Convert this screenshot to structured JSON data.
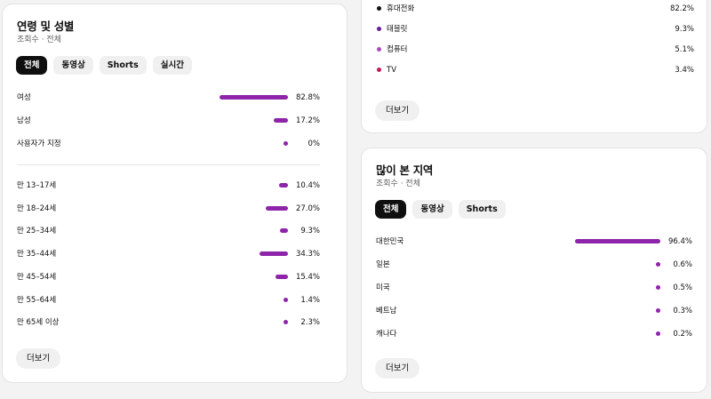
{
  "age_gender": {
    "title": "연령 및 성별",
    "subtitle": "조회수 · 전체",
    "chips": [
      "전체",
      "동영상",
      "Shorts",
      "실시간"
    ],
    "gender_rows": [
      {
        "label": "여성",
        "value": 82.8,
        "pct": "82.8%"
      },
      {
        "label": "남성",
        "value": 17.2,
        "pct": "17.2%"
      },
      {
        "label": "사용자가 지정",
        "value": 0,
        "pct": "0%"
      }
    ],
    "age_rows": [
      {
        "label": "만 13–17세",
        "value": 10.4,
        "pct": "10.4%"
      },
      {
        "label": "만 18–24세",
        "value": 27.0,
        "pct": "27.0%"
      },
      {
        "label": "만 25–34세",
        "value": 9.3,
        "pct": "9.3%"
      },
      {
        "label": "만 35–44세",
        "value": 34.3,
        "pct": "34.3%"
      },
      {
        "label": "만 45–54세",
        "value": 15.4,
        "pct": "15.4%"
      },
      {
        "label": "만 55–64세",
        "value": 1.4,
        "pct": "1.4%"
      },
      {
        "label": "만 65세 이상",
        "value": 2.3,
        "pct": "2.3%"
      }
    ],
    "more_label": "더보기"
  },
  "devices": {
    "rows": [
      {
        "label": "휴대전화",
        "pct": "82.2%",
        "color": "#0f0f0f"
      },
      {
        "label": "태블릿",
        "pct": "9.3%",
        "color": "#6a1b9a"
      },
      {
        "label": "컴퓨터",
        "pct": "5.1%",
        "color": "#ab47bc"
      },
      {
        "label": "TV",
        "pct": "3.4%",
        "color": "#c2185b"
      }
    ],
    "more_label": "더보기"
  },
  "regions": {
    "title": "많이 본 지역",
    "subtitle": "조회수 · 전체",
    "chips": [
      "전체",
      "동영상",
      "Shorts"
    ],
    "rows": [
      {
        "label": "대한민국",
        "value": 96.4,
        "pct": "96.4%"
      },
      {
        "label": "일본",
        "value": 0.6,
        "pct": "0.6%"
      },
      {
        "label": "미국",
        "value": 0.5,
        "pct": "0.5%"
      },
      {
        "label": "베트남",
        "value": 0.3,
        "pct": "0.3%"
      },
      {
        "label": "캐나다",
        "value": 0.2,
        "pct": "0.2%"
      }
    ],
    "more_label": "더보기"
  },
  "colors": {
    "bar": "#8e24aa",
    "chip_active": "#0f0f0f"
  }
}
